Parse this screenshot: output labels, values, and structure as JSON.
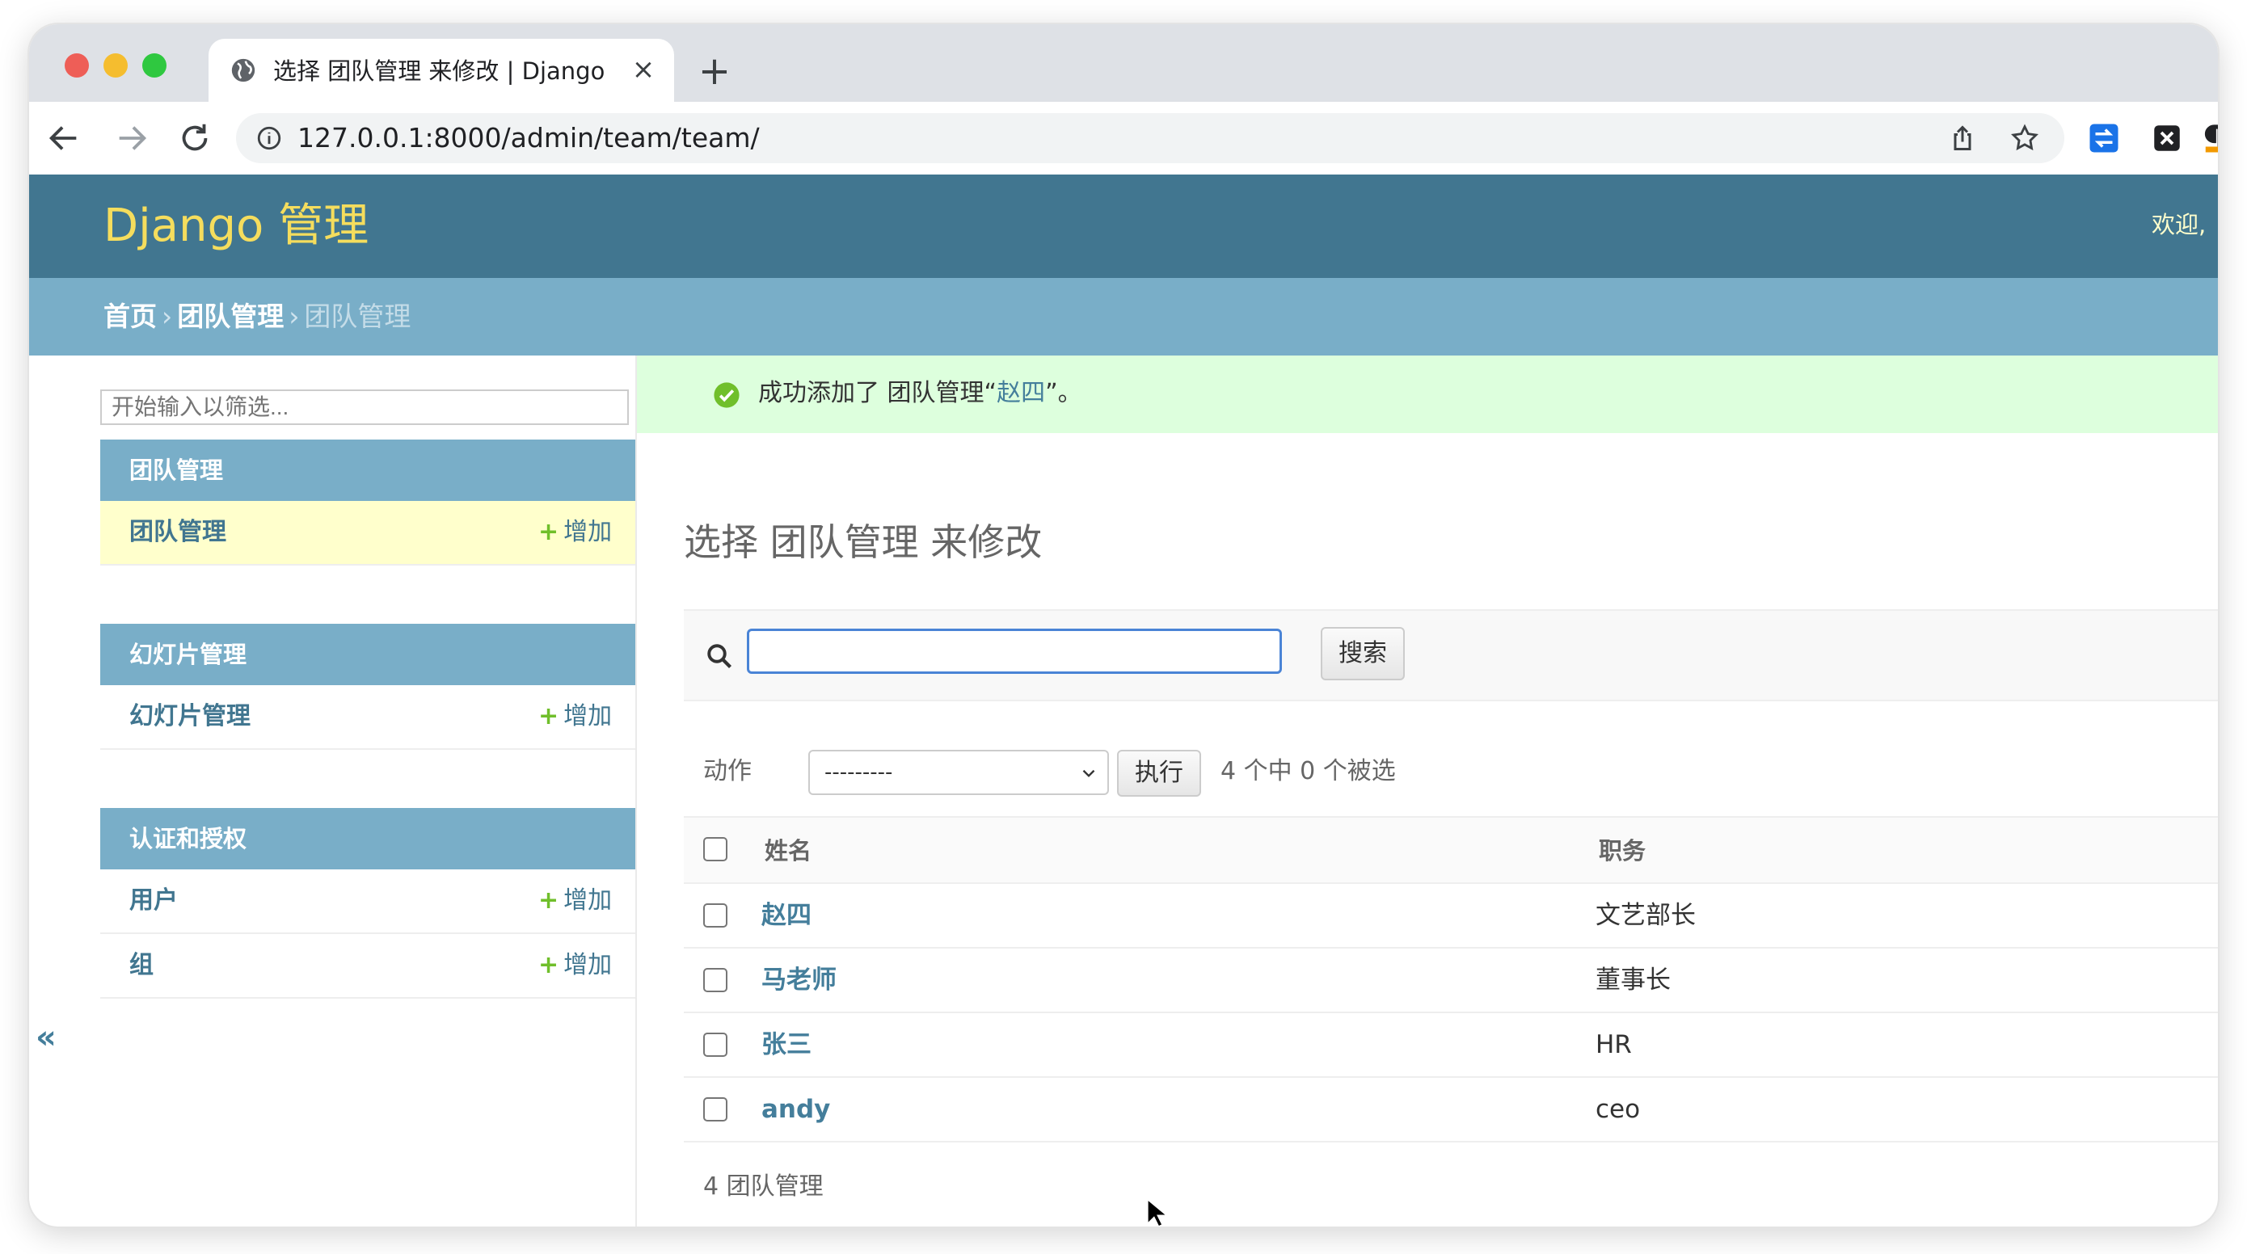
{
  "browser": {
    "tab_title": "选择 团队管理 来修改 | Django 站",
    "url": "127.0.0.1:8000/admin/team/team/"
  },
  "header": {
    "brand": "Django 管理",
    "welcome": "欢迎,"
  },
  "breadcrumbs": {
    "home": "首页",
    "app": "团队管理",
    "current": "团队管理",
    "separator": "›"
  },
  "sidebar": {
    "filter_placeholder": "开始输入以筛选...",
    "collapse_glyph": "«",
    "add_label": "增加",
    "modules": [
      {
        "caption": "团队管理",
        "items": [
          {
            "label": "团队管理"
          }
        ]
      },
      {
        "caption": "幻灯片管理",
        "items": [
          {
            "label": "幻灯片管理"
          }
        ]
      },
      {
        "caption": "认证和授权",
        "items": [
          {
            "label": "用户"
          },
          {
            "label": "组"
          }
        ]
      }
    ]
  },
  "message": {
    "prefix": "成功添加了 团队管理“",
    "link": "赵四",
    "suffix": "”。"
  },
  "content": {
    "title": "选择 团队管理 来修改",
    "search_button": "搜索",
    "search_value": "",
    "actions_label": "动作",
    "actions_selected": "---------",
    "run_button": "执行",
    "selection_counter": "4 个中 0 个被选",
    "columns": {
      "name": "姓名",
      "role": "职务"
    },
    "rows": [
      {
        "name": "赵四",
        "role": "文艺部长"
      },
      {
        "name": "马老师",
        "role": "董事长"
      },
      {
        "name": "张三",
        "role": "HR"
      },
      {
        "name": "andy",
        "role": "ceo"
      }
    ],
    "paginator": "4 团队管理"
  },
  "colors": {
    "header_bg": "#417690",
    "brand": "#f5dd5d",
    "breadcrumb_bg": "#79aec8",
    "link": "#447e9b",
    "success_bg": "#ddffdd",
    "add_plus": "#70bf2b",
    "active_row": "#ffffcc"
  }
}
